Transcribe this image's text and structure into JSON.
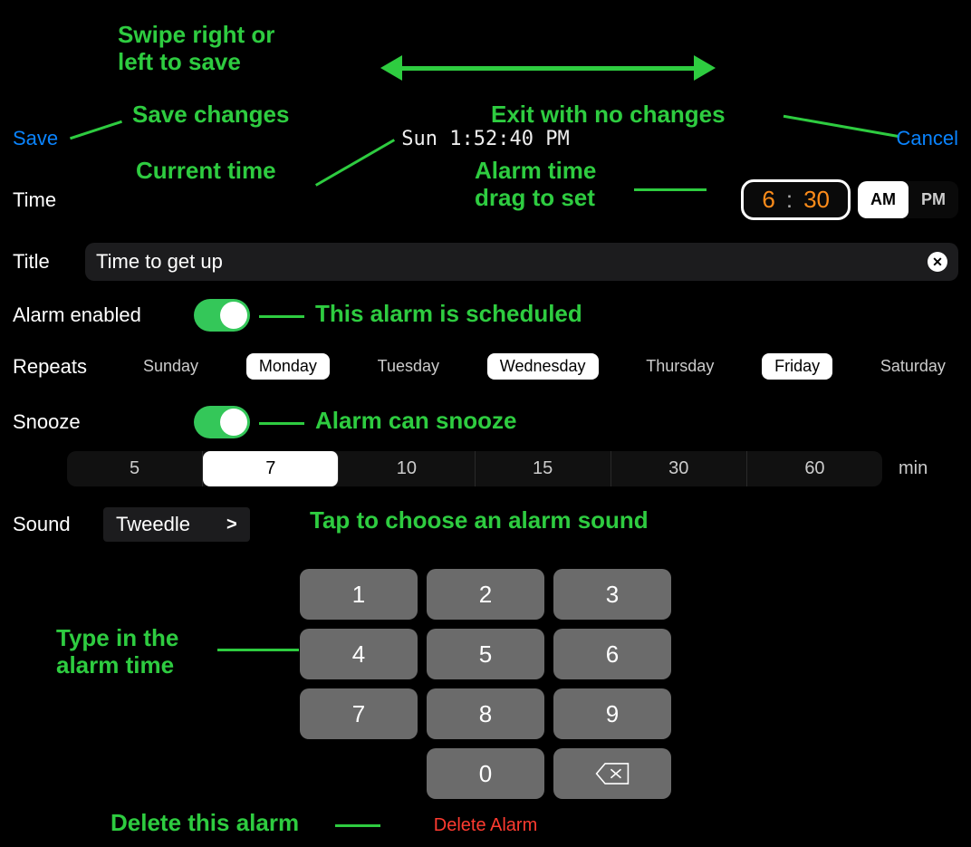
{
  "annotations": {
    "swipe": "Swipe right or\nleft to save",
    "save_changes": "Save changes",
    "exit_no_changes": "Exit with no changes",
    "current_time": "Current time",
    "alarm_time_drag": "Alarm time\ndrag to set",
    "alarm_scheduled": "This alarm is scheduled",
    "alarm_can_snooze": "Alarm can snooze",
    "tap_sound": "Tap to choose an alarm sound",
    "type_in": "Type in the\nalarm time",
    "delete_this": "Delete this alarm"
  },
  "topbar": {
    "save": "Save",
    "cancel": "Cancel",
    "clock": "Sun 1:52:40 PM"
  },
  "time": {
    "label": "Time",
    "hour": "6",
    "minute": "30",
    "am": "AM",
    "pm": "PM",
    "selected_period": "AM"
  },
  "title": {
    "label": "Title",
    "value": "Time to get up"
  },
  "enabled": {
    "label": "Alarm enabled",
    "value": true
  },
  "repeats": {
    "label": "Repeats",
    "days": [
      {
        "label": "Sunday",
        "selected": false
      },
      {
        "label": "Monday",
        "selected": true
      },
      {
        "label": "Tuesday",
        "selected": false
      },
      {
        "label": "Wednesday",
        "selected": true
      },
      {
        "label": "Thursday",
        "selected": false
      },
      {
        "label": "Friday",
        "selected": true
      },
      {
        "label": "Saturday",
        "selected": false
      }
    ]
  },
  "snooze": {
    "label": "Snooze",
    "value": true,
    "options": [
      "5",
      "7",
      "10",
      "15",
      "30",
      "60"
    ],
    "selected": "7",
    "unit": "min"
  },
  "sound": {
    "label": "Sound",
    "value": "Tweedle"
  },
  "keypad": {
    "keys": [
      "1",
      "2",
      "3",
      "4",
      "5",
      "6",
      "7",
      "8",
      "9",
      "",
      "0",
      "backspace"
    ]
  },
  "delete": {
    "label": "Delete Alarm"
  }
}
